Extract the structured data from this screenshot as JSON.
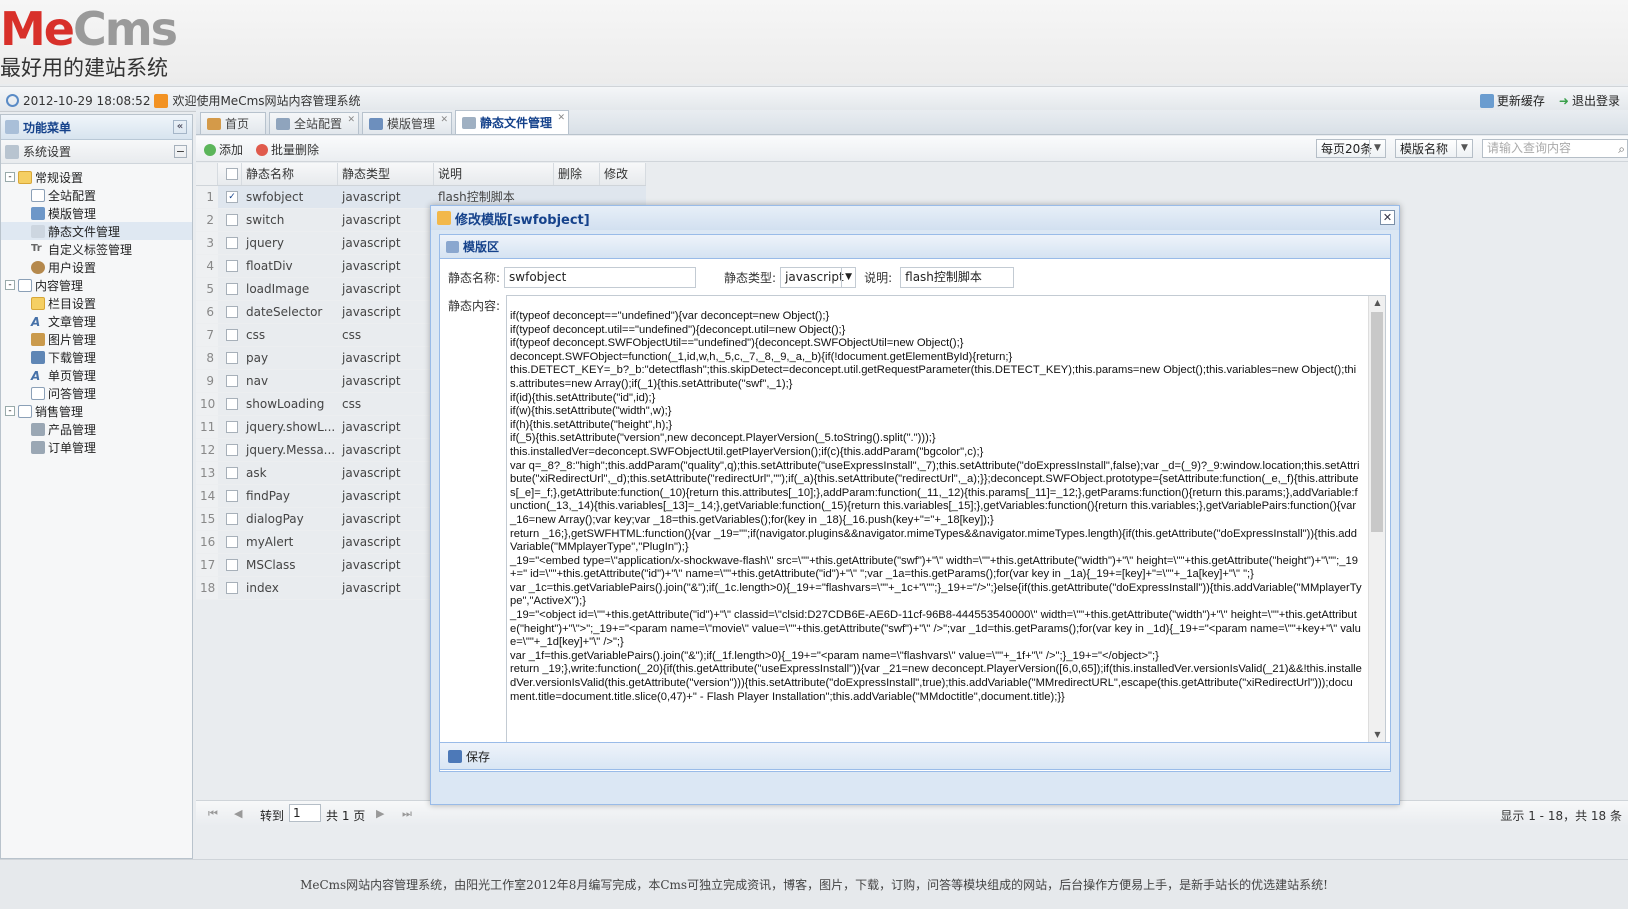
{
  "brand": {
    "logo_me": "Me",
    "logo_cms": "Cms",
    "slogan": "最好用的建站系统"
  },
  "status": {
    "datetime": "2012-10-29 18:08:52",
    "welcome": "欢迎使用MeCms网站内容管理系统",
    "refresh_cache": "更新缓存",
    "logout": "退出登录"
  },
  "sidebar": {
    "title": "功能菜单",
    "section": "系统设置",
    "tree": [
      {
        "label": "常规设置",
        "level": 0,
        "toggle": "-",
        "icon": "folder"
      },
      {
        "label": "全站配置",
        "level": 1,
        "icon": "page"
      },
      {
        "label": "模版管理",
        "level": 1,
        "icon": "blue"
      },
      {
        "label": "静态文件管理",
        "level": 1,
        "icon": "code",
        "selected": true
      },
      {
        "label": "自定义标签管理",
        "level": 1,
        "icon": "text"
      },
      {
        "label": "用户设置",
        "level": 1,
        "icon": "user"
      },
      {
        "label": "内容管理",
        "level": 0,
        "toggle": "-",
        "icon": "page"
      },
      {
        "label": "栏目设置",
        "level": 1,
        "icon": "folder"
      },
      {
        "label": "文章管理",
        "level": 1,
        "icon": "art"
      },
      {
        "label": "图片管理",
        "level": 1,
        "icon": "img"
      },
      {
        "label": "下载管理",
        "level": 1,
        "icon": "dl"
      },
      {
        "label": "单页管理",
        "level": 1,
        "icon": "art"
      },
      {
        "label": "问答管理",
        "level": 1,
        "icon": "page"
      },
      {
        "label": "销售管理",
        "level": 0,
        "toggle": "-",
        "icon": "page"
      },
      {
        "label": "产品管理",
        "level": 1,
        "icon": "cart"
      },
      {
        "label": "订单管理",
        "level": 1,
        "icon": "cart"
      }
    ]
  },
  "tabs": [
    {
      "label": "首页",
      "closable": false
    },
    {
      "label": "全站配置",
      "closable": true
    },
    {
      "label": "模版管理",
      "closable": true
    },
    {
      "label": "静态文件管理",
      "closable": true,
      "active": true
    }
  ],
  "toolbar": {
    "add": "添加",
    "batch_delete": "批量删除",
    "page_size": "每页20条",
    "search_field": "模版名称",
    "search_placeholder": "请输入查询内容"
  },
  "grid": {
    "columns": [
      "静态名称",
      "静态类型",
      "说明",
      "删除",
      "修改"
    ],
    "rows": [
      {
        "n": "1",
        "name": "swfobject",
        "type": "javascript",
        "desc": "flash控制脚本",
        "checked": true
      },
      {
        "n": "2",
        "name": "switch",
        "type": "javascript",
        "desc": ""
      },
      {
        "n": "3",
        "name": "jquery",
        "type": "javascript",
        "desc": ""
      },
      {
        "n": "4",
        "name": "floatDiv",
        "type": "javascript",
        "desc": ""
      },
      {
        "n": "5",
        "name": "loadImage",
        "type": "javascript",
        "desc": ""
      },
      {
        "n": "6",
        "name": "dateSelector",
        "type": "javascript",
        "desc": ""
      },
      {
        "n": "7",
        "name": "css",
        "type": "css",
        "desc": ""
      },
      {
        "n": "8",
        "name": "pay",
        "type": "javascript",
        "desc": ""
      },
      {
        "n": "9",
        "name": "nav",
        "type": "javascript",
        "desc": ""
      },
      {
        "n": "10",
        "name": "showLoading",
        "type": "css",
        "desc": ""
      },
      {
        "n": "11",
        "name": "jquery.showL...",
        "type": "javascript",
        "desc": ""
      },
      {
        "n": "12",
        "name": "jquery.Messa...",
        "type": "javascript",
        "desc": ""
      },
      {
        "n": "13",
        "name": "ask",
        "type": "javascript",
        "desc": ""
      },
      {
        "n": "14",
        "name": "findPay",
        "type": "javascript",
        "desc": ""
      },
      {
        "n": "15",
        "name": "dialogPay",
        "type": "javascript",
        "desc": ""
      },
      {
        "n": "16",
        "name": "myAlert",
        "type": "javascript",
        "desc": ""
      },
      {
        "n": "17",
        "name": "MSClass",
        "type": "javascript",
        "desc": ""
      },
      {
        "n": "18",
        "name": "index",
        "type": "javascript",
        "desc": ""
      }
    ]
  },
  "pager": {
    "goto": "转到",
    "page": "1",
    "total_pages": "共 1 页",
    "info": "显示 1 - 18，共 18 条"
  },
  "dialog": {
    "title": "修改模版[swfobject]",
    "section": "模版区",
    "name_label": "静态名称:",
    "name_value": "swfobject",
    "type_label": "静态类型:",
    "type_value": "javascript",
    "desc_label": "说明:",
    "desc_value": "flash控制脚本",
    "content_label": "静态内容:",
    "content": "if(typeof deconcept==\"undefined\"){var deconcept=new Object();}\nif(typeof deconcept.util==\"undefined\"){deconcept.util=new Object();}\nif(typeof deconcept.SWFObjectUtil==\"undefined\"){deconcept.SWFObjectUtil=new Object();}\ndeconcept.SWFObject=function(_1,id,w,h,_5,c,_7,_8,_9,_a,_b){if(!document.getElementById){return;}\nthis.DETECT_KEY=_b?_b:\"detectflash\";this.skipDetect=deconcept.util.getRequestParameter(this.DETECT_KEY);this.params=new Object();this.variables=new Object();this.attributes=new Array();if(_1){this.setAttribute(\"swf\",_1);}\nif(id){this.setAttribute(\"id\",id);}\nif(w){this.setAttribute(\"width\",w);}\nif(h){this.setAttribute(\"height\",h);}\nif(_5){this.setAttribute(\"version\",new deconcept.PlayerVersion(_5.toString().split(\".\")));}\nthis.installedVer=deconcept.SWFObjectUtil.getPlayerVersion();if(c){this.addParam(\"bgcolor\",c);}\nvar q=_8?_8:\"high\";this.addParam(\"quality\",q);this.setAttribute(\"useExpressInstall\",_7);this.setAttribute(\"doExpressInstall\",false);var _d=(_9)?_9:window.location;this.setAttribute(\"xiRedirectUrl\",_d);this.setAttribute(\"redirectUrl\",\"\");if(_a){this.setAttribute(\"redirectUrl\",_a);}};deconcept.SWFObject.prototype={setAttribute:function(_e,_f){this.attributes[_e]=_f;},getAttribute:function(_10){return this.attributes[_10];},addParam:function(_11,_12){this.params[_11]=_12;},getParams:function(){return this.params;},addVariable:function(_13,_14){this.variables[_13]=_14;},getVariable:function(_15){return this.variables[_15];},getVariables:function(){return this.variables;},getVariablePairs:function(){var _16=new Array();var key;var _18=this.getVariables();for(key in _18){_16.push(key+\"=\"+_18[key]);}\nreturn _16;},getSWFHTML:function(){var _19=\"\";if(navigator.plugins&&navigator.mimeTypes&&navigator.mimeTypes.length){if(this.getAttribute(\"doExpressInstall\")){this.addVariable(\"MMplayerType\",\"PlugIn\");}\n_19=\"<embed type=\\\"application/x-shockwave-flash\\\" src=\\\"\"+this.getAttribute(\"swf\")+\"\\\" width=\\\"\"+this.getAttribute(\"width\")+\"\\\" height=\\\"\"+this.getAttribute(\"height\")+\"\\\"\";_19+=\" id=\\\"\"+this.getAttribute(\"id\")+\"\\\" name=\\\"\"+this.getAttribute(\"id\")+\"\\\" \";var _1a=this.getParams();for(var key in _1a){_19+=[key]+\"=\\\"\"+_1a[key]+\"\\\" \";}\nvar _1c=this.getVariablePairs().join(\"&\");if(_1c.length>0){_19+=\"flashvars=\\\"\"+_1c+\"\\\"\";}_19+=\"/>\";}else{if(this.getAttribute(\"doExpressInstall\")){this.addVariable(\"MMplayerType\",\"ActiveX\");}\n_19=\"<object id=\\\"\"+this.getAttribute(\"id\")+\"\\\" classid=\\\"clsid:D27CDB6E-AE6D-11cf-96B8-444553540000\\\" width=\\\"\"+this.getAttribute(\"width\")+\"\\\" height=\\\"\"+this.getAttribute(\"height\")+\"\\\">\";_19+=\"<param name=\\\"movie\\\" value=\\\"\"+this.getAttribute(\"swf\")+\"\\\" />\";var _1d=this.getParams();for(var key in _1d){_19+=\"<param name=\\\"\"+key+\"\\\" value=\\\"\"+_1d[key]+\"\\\" />\";}\nvar _1f=this.getVariablePairs().join(\"&\");if(_1f.length>0){_19+=\"<param name=\\\"flashvars\\\" value=\\\"\"+_1f+\"\\\" />\";}_19+=\"</object>\";}\nreturn _19;},write:function(_20){if(this.getAttribute(\"useExpressInstall\")){var _21=new deconcept.PlayerVersion([6,0,65]);if(this.installedVer.versionIsValid(_21)&&!this.installedVer.versionIsValid(this.getAttribute(\"version\"))){this.setAttribute(\"doExpressInstall\",true);this.addVariable(\"MMredirectURL\",escape(this.getAttribute(\"xiRedirectUrl\")));document.title=document.title.slice(0,47)+\" - Flash Player Installation\";this.addVariable(\"MMdoctitle\",document.title);}}",
    "save": "保存"
  },
  "footer": "MeCms网站内容管理系统，由阳光工作室2012年8月编写完成，本Cms可独立完成资讯，博客，图片，下载，订购，问答等模块组成的网站，后台操作方便易上手，是新手站长的优选建站系统!"
}
